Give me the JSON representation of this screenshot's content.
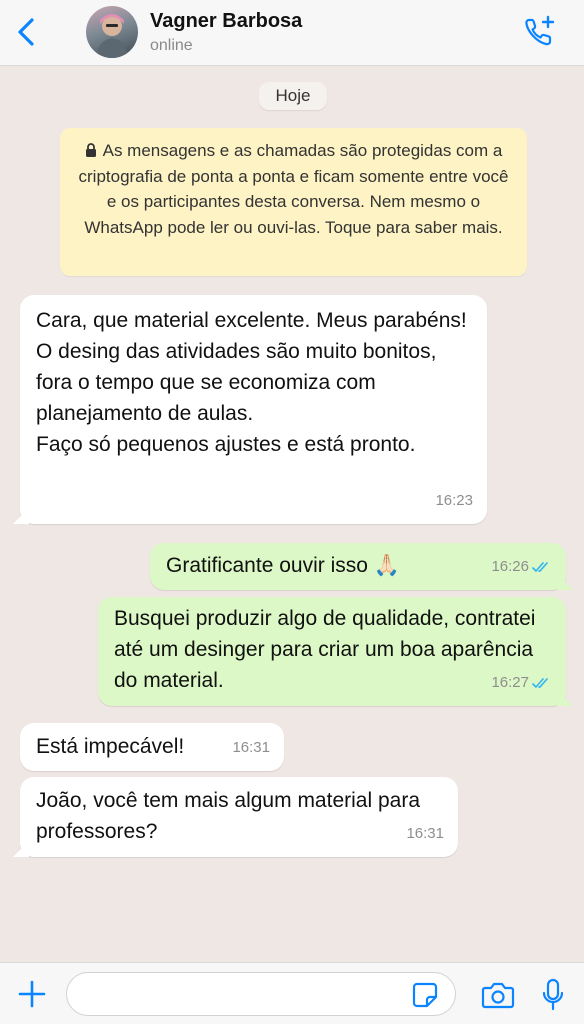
{
  "header": {
    "contact_name": "Vagner Barbosa",
    "status": "online",
    "accent_color": "#0a84ff"
  },
  "chat": {
    "date_label": "Hoje",
    "encryption_notice": "As mensagens e as chamadas são protegidas com a criptografia de ponta a ponta e ficam somente entre você e os participantes desta conversa. Nem mesmo o WhatsApp pode ler ou ouvi-las. Toque para saber mais.",
    "messages": [
      {
        "direction": "incoming",
        "text": "Cara, que material excelente. Meus parabéns!\nO desing das atividades são muito bonitos, fora o tempo que se economiza com planejamento de aulas.\nFaço só pequenos ajustes e está pronto.",
        "time": "16:23"
      },
      {
        "direction": "outgoing",
        "text": "Gratificante ouvir isso 🙏🏻",
        "time": "16:26",
        "read": true
      },
      {
        "direction": "outgoing",
        "text": "Busquei produzir algo de qualidade, contratei até um desinger para criar um boa aparência do material.",
        "time": "16:27",
        "read": true
      },
      {
        "direction": "incoming",
        "text": "Está impecável!",
        "time": "16:31"
      },
      {
        "direction": "incoming",
        "text": "João, você tem mais algum material para professores?",
        "time": "16:31"
      }
    ]
  },
  "input": {
    "placeholder": "",
    "value": ""
  },
  "colors": {
    "incoming_bubble": "#ffffff",
    "outgoing_bubble": "#dcf8c6",
    "chat_background": "#efe7e4",
    "notice_background": "#fdf3c4",
    "read_ticks": "#34b7f1"
  },
  "icons": {
    "back": "chevron-left-icon",
    "call": "add-call-icon",
    "lock": "lock-icon",
    "plus": "plus-icon",
    "sticker": "sticker-icon",
    "camera": "camera-icon",
    "mic": "microphone-icon"
  }
}
